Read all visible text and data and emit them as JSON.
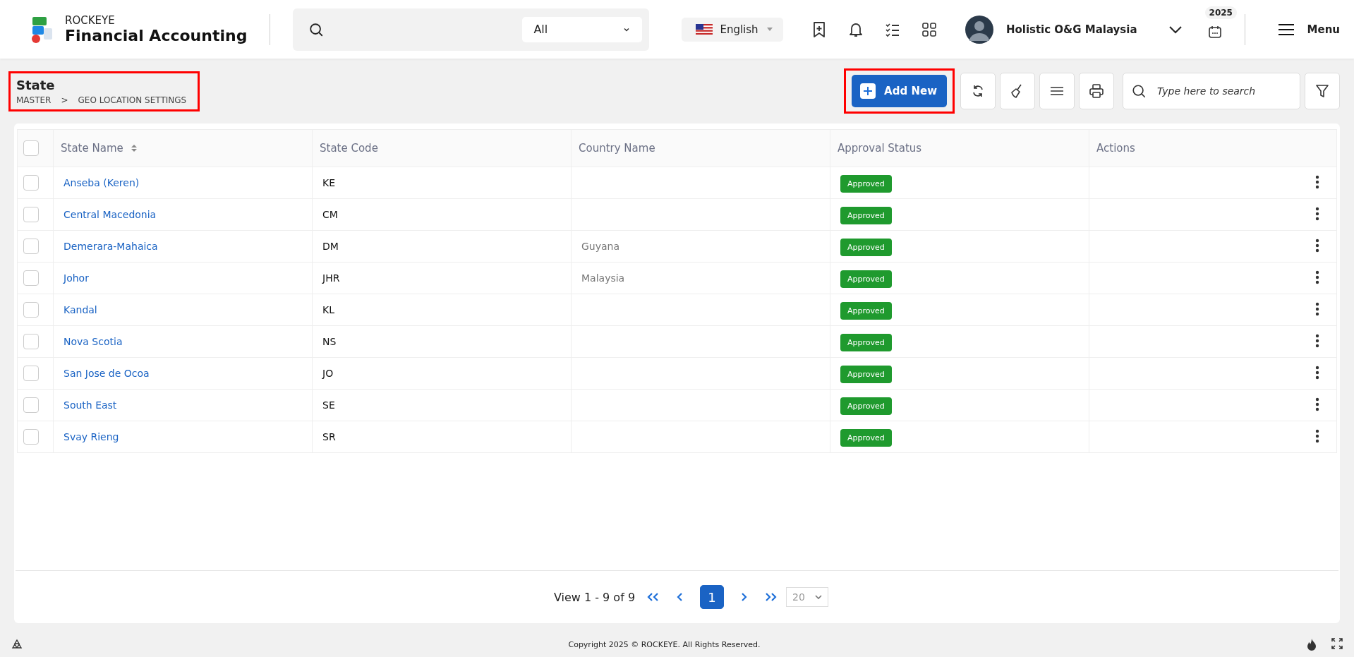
{
  "header": {
    "brand": {
      "company": "ROCKEYE",
      "product": "Financial Accounting"
    },
    "search": {
      "filter": "All"
    },
    "language": "English",
    "user_name": "Holistic O&G Malaysia",
    "year": "2025",
    "menu_label": "Menu"
  },
  "page": {
    "title": "State",
    "breadcrumb": [
      "MASTER",
      "GEO LOCATION SETTINGS"
    ],
    "separator": ">",
    "highlighted": true
  },
  "toolbar": {
    "add_button": {
      "label": "Add New",
      "highlighted": true
    },
    "search": {
      "placeholder": "Type here to search"
    }
  },
  "table": {
    "select_all": {
      "checked": false
    },
    "columns": [
      {
        "label": "State Name",
        "sortable": true
      },
      {
        "label": "State Code",
        "sortable": false
      },
      {
        "label": "Country Name",
        "sortable": false
      },
      {
        "label": "Approval Status",
        "sortable": false
      },
      {
        "label": "Actions",
        "sortable": false
      }
    ],
    "rows": [
      {
        "checked": false,
        "state_name": "Anseba (Keren)",
        "state_code": "KE",
        "status": "Approved"
      },
      {
        "checked": false,
        "state_name": "Central Macedonia",
        "state_code": "CM",
        "status": "Approved"
      },
      {
        "checked": false,
        "state_name": "Demerara-Mahaica",
        "state_code": "DM",
        "country_name": "Guyana",
        "status": "Approved"
      },
      {
        "checked": false,
        "state_name": "Johor",
        "state_code": "JHR",
        "country_name": "Malaysia",
        "status": "Approved"
      },
      {
        "checked": false,
        "state_name": "Kandal",
        "state_code": "KL",
        "status": "Approved"
      },
      {
        "checked": false,
        "state_name": "Nova Scotia",
        "state_code": "NS",
        "status": "Approved"
      },
      {
        "checked": false,
        "state_name": "San Jose de Ocoa",
        "state_code": "JO",
        "status": "Approved"
      },
      {
        "checked": false,
        "state_name": "South East",
        "state_code": "SE",
        "status": "Approved"
      },
      {
        "checked": false,
        "state_name": "Svay Rieng",
        "state_code": "SR",
        "status": "Approved"
      }
    ]
  },
  "pagination": {
    "summary": "View 1 - 9 of 9",
    "pages": [
      {
        "label": "1",
        "selected": true
      }
    ],
    "page_size": "20"
  },
  "footer": {
    "copyright": "Copyright 2025 © ROCKEYE. All Rights Reserved."
  }
}
